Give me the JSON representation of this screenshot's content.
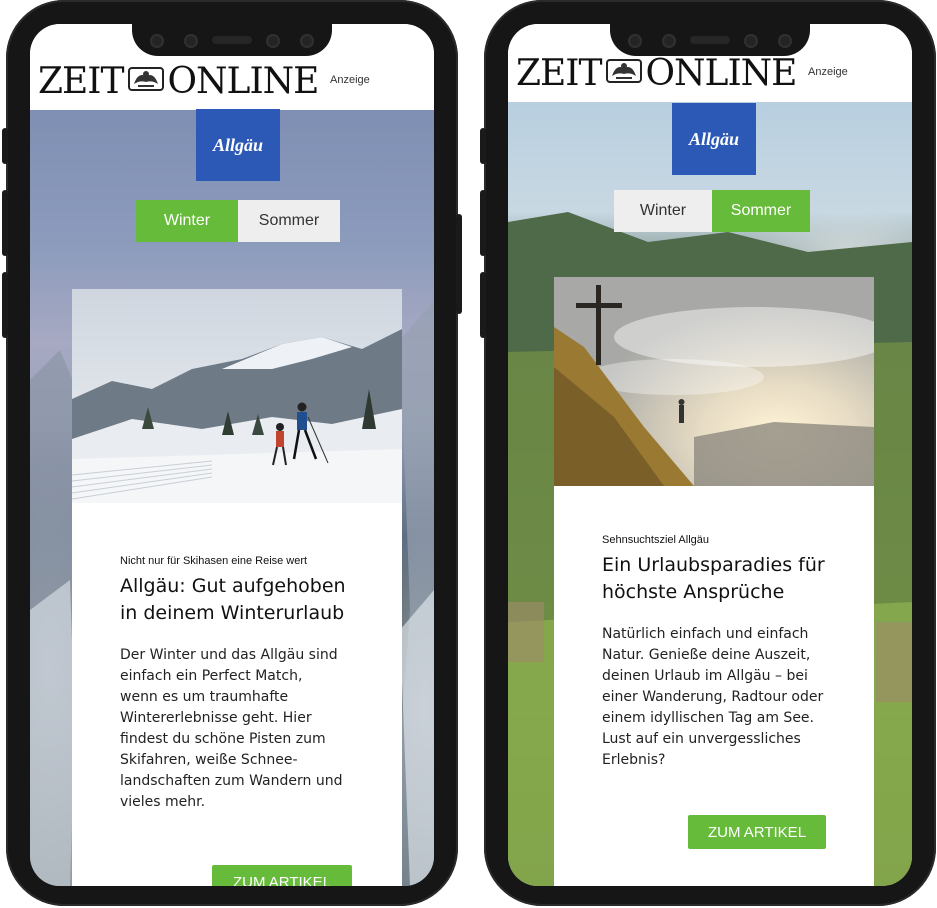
{
  "colors": {
    "accent_green": "#67bb3a",
    "brand_blue": "#2b59b5",
    "phone_frame": "#161616"
  },
  "left": {
    "header": {
      "logo_left": "ZEIT",
      "logo_right": "ONLINE",
      "ad_label": "Anzeige"
    },
    "brand": {
      "name": "Allgäu"
    },
    "season_toggle": {
      "option_1": "Winter",
      "option_2": "Sommer",
      "active": "Winter"
    },
    "card": {
      "kicker": "Nicht nur für Skihasen eine Reise wert",
      "headline_line1": "Allgäu: Gut aufgehoben",
      "headline_line2": "in deinem Winterurlaub",
      "body_lines": [
        "Der Winter und das Allgäu sind",
        "einfach ein Perfect Match,",
        "wenn es um traumhafte",
        "Wintererlebnisse geht. Hier",
        "findest du schöne Pisten zum",
        "Skifahren, weiße Schnee-",
        "landschaften zum Wandern und",
        "vieles mehr."
      ],
      "cta_label": "ZUM ARTIKEL"
    }
  },
  "right": {
    "header": {
      "logo_left": "ZEIT",
      "logo_right": "ONLINE",
      "ad_label": "Anzeige"
    },
    "brand": {
      "name": "Allgäu"
    },
    "season_toggle": {
      "option_1": "Winter",
      "option_2": "Sommer",
      "active": "Sommer"
    },
    "card": {
      "kicker": "Sehnsuchtsziel Allgäu",
      "headline_line1": "Ein Urlaubsparadies für",
      "headline_line2": "höchste Ansprüche",
      "body_lines": [
        "Natürlich einfach und einfach",
        "Natur. Genieße deine Auszeit,",
        "deinen Urlaub im Allgäu – bei",
        "einer Wanderung, Radtour oder",
        "einem idyllischen Tag am See.",
        "Lust auf ein unvergessliches",
        "Erlebnis?"
      ],
      "cta_label": "ZUM ARTIKEL"
    }
  }
}
